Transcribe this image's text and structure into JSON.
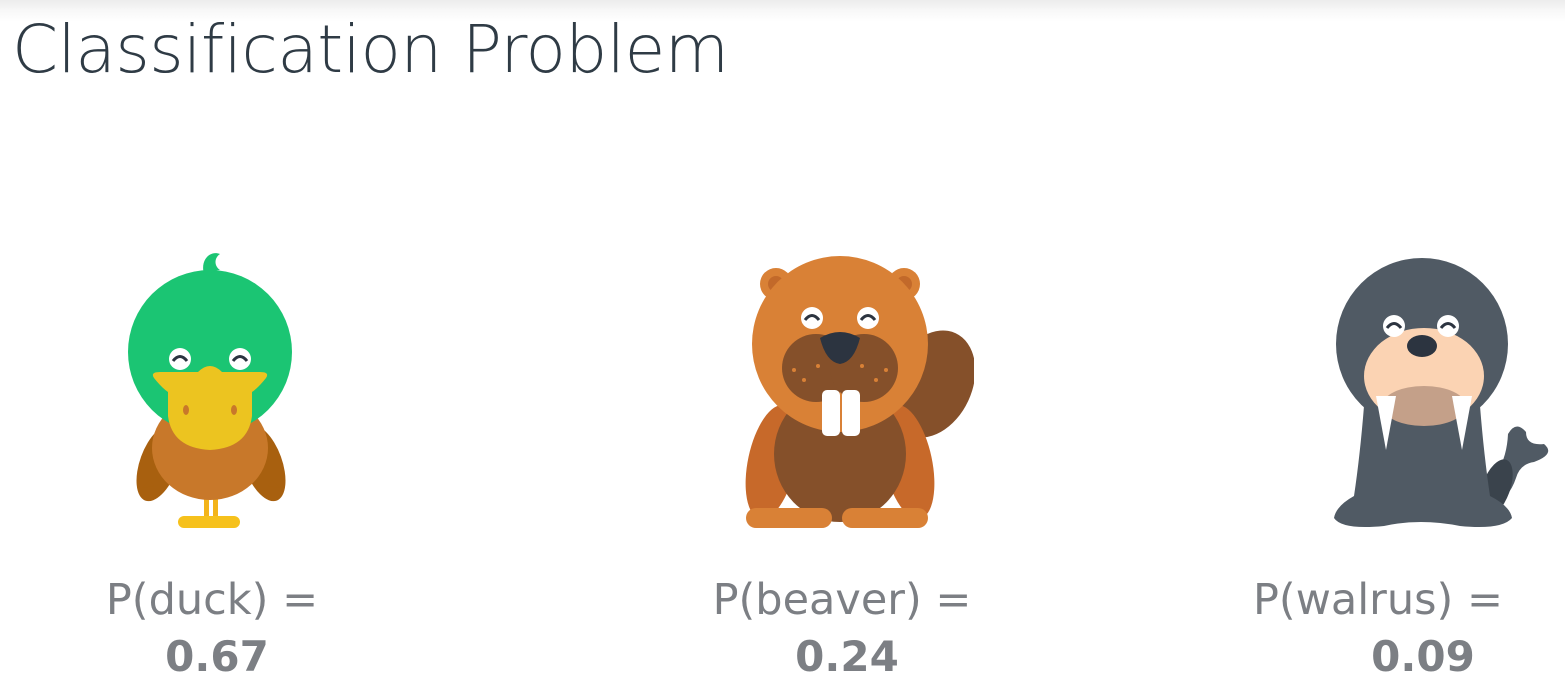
{
  "title": "Classification Problem",
  "classes": [
    {
      "icon": "duck-icon",
      "label": "P(duck) =",
      "value": "0.67",
      "probability": 0.67
    },
    {
      "icon": "beaver-icon",
      "label": "P(beaver) =",
      "value": "0.24",
      "probability": 0.24
    },
    {
      "icon": "walrus-icon",
      "label": "P(walrus) =",
      "value": "0.09",
      "probability": 0.09
    }
  ],
  "colors": {
    "title": "#2f3b45",
    "label": "#7c7f84",
    "duck_head": "#1bc573",
    "duck_bill": "#ecc420",
    "duck_body": "#c8782a",
    "beaver_head": "#d98136",
    "beaver_body": "#85502a",
    "walrus_body": "#505a64",
    "walrus_face": "#fbd3b3"
  }
}
